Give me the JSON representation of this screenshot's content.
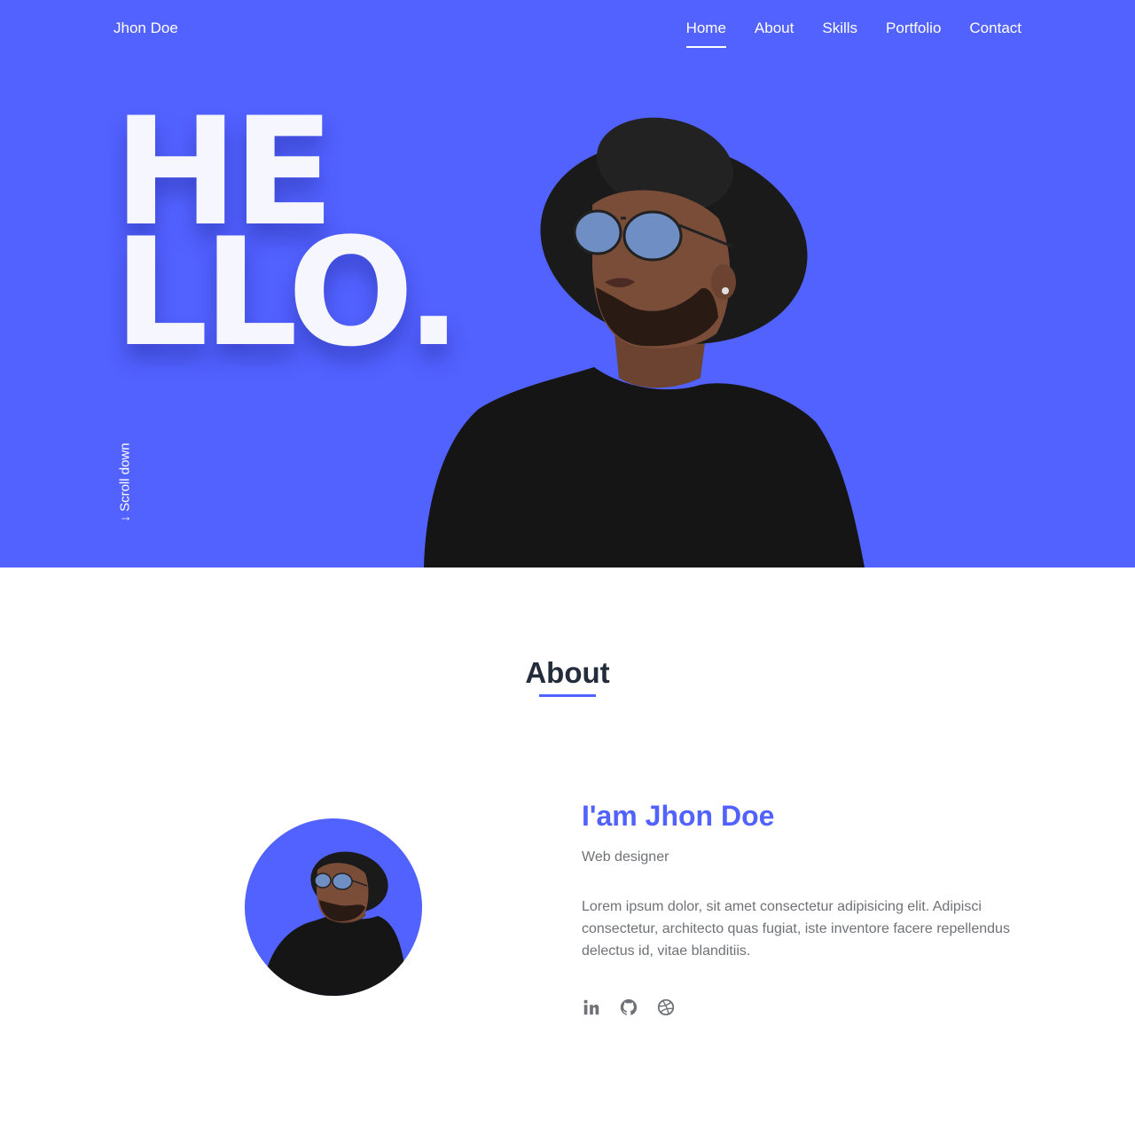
{
  "header": {
    "brand": "Jhon Doe",
    "nav": [
      {
        "label": "Home",
        "active": true
      },
      {
        "label": "About",
        "active": false
      },
      {
        "label": "Skills",
        "active": false
      },
      {
        "label": "Portfolio",
        "active": false
      },
      {
        "label": "Contact",
        "active": false
      }
    ]
  },
  "hero": {
    "title_line1": "HE",
    "title_line2": "LLO.",
    "scroll_label": "↓ Scroll down"
  },
  "about": {
    "section_title": "About",
    "name_heading": "I'am Jhon Doe",
    "role": "Web designer",
    "description": "Lorem ipsum dolor, sit amet consectetur adipisicing elit. Adipisci consectetur, architecto quas fugiat, iste inventore facere repellendus delectus id, vitae blanditiis.",
    "socials": [
      {
        "icon": "linkedin-icon"
      },
      {
        "icon": "github-icon"
      },
      {
        "icon": "dribbble-icon"
      }
    ]
  },
  "colors": {
    "accent": "#5262ff",
    "heading": "#232c3a",
    "body_text": "#6f7276",
    "hero_text": "#f6f6ff"
  }
}
